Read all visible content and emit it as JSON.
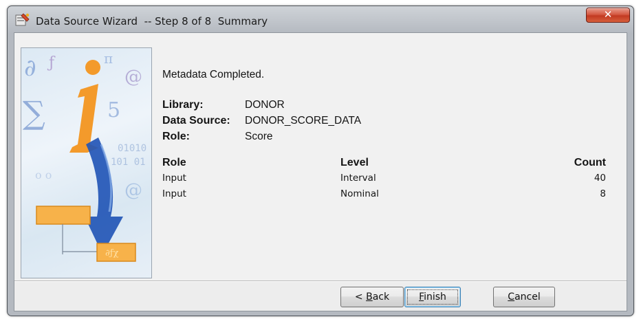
{
  "window": {
    "title": "Data Source Wizard  -- Step 8 of 8  Summary",
    "close_label": "✕",
    "app_icon": "wizard-app-icon"
  },
  "side_image": {
    "icon": "info-arrow-illustration",
    "colors": {
      "info_orange": "#f39a2b",
      "arrow_blue": "#1f4fb0"
    }
  },
  "summary": {
    "message": "Metadata Completed.",
    "fields": [
      {
        "label": "Library:",
        "value": "DONOR"
      },
      {
        "label": "Data Source:",
        "value": "DONOR_SCORE_DATA"
      },
      {
        "label": "Role:",
        "value": "Score"
      }
    ],
    "table": {
      "headers": {
        "role": "Role",
        "level": "Level",
        "count": "Count"
      },
      "rows": [
        {
          "role": "Input",
          "level": "Interval",
          "count": "40"
        },
        {
          "role": "Input",
          "level": "Nominal",
          "count": "8"
        }
      ]
    }
  },
  "buttons": {
    "back": {
      "pre": "< ",
      "mnemonic": "B",
      "rest": "ack"
    },
    "finish": {
      "pre": "",
      "mnemonic": "F",
      "rest": "inish"
    },
    "cancel": {
      "pre": "",
      "mnemonic": "C",
      "rest": "ancel"
    }
  },
  "colors": {
    "accent_default_button": "#3c7fb1",
    "close_button": "#c23a22"
  }
}
